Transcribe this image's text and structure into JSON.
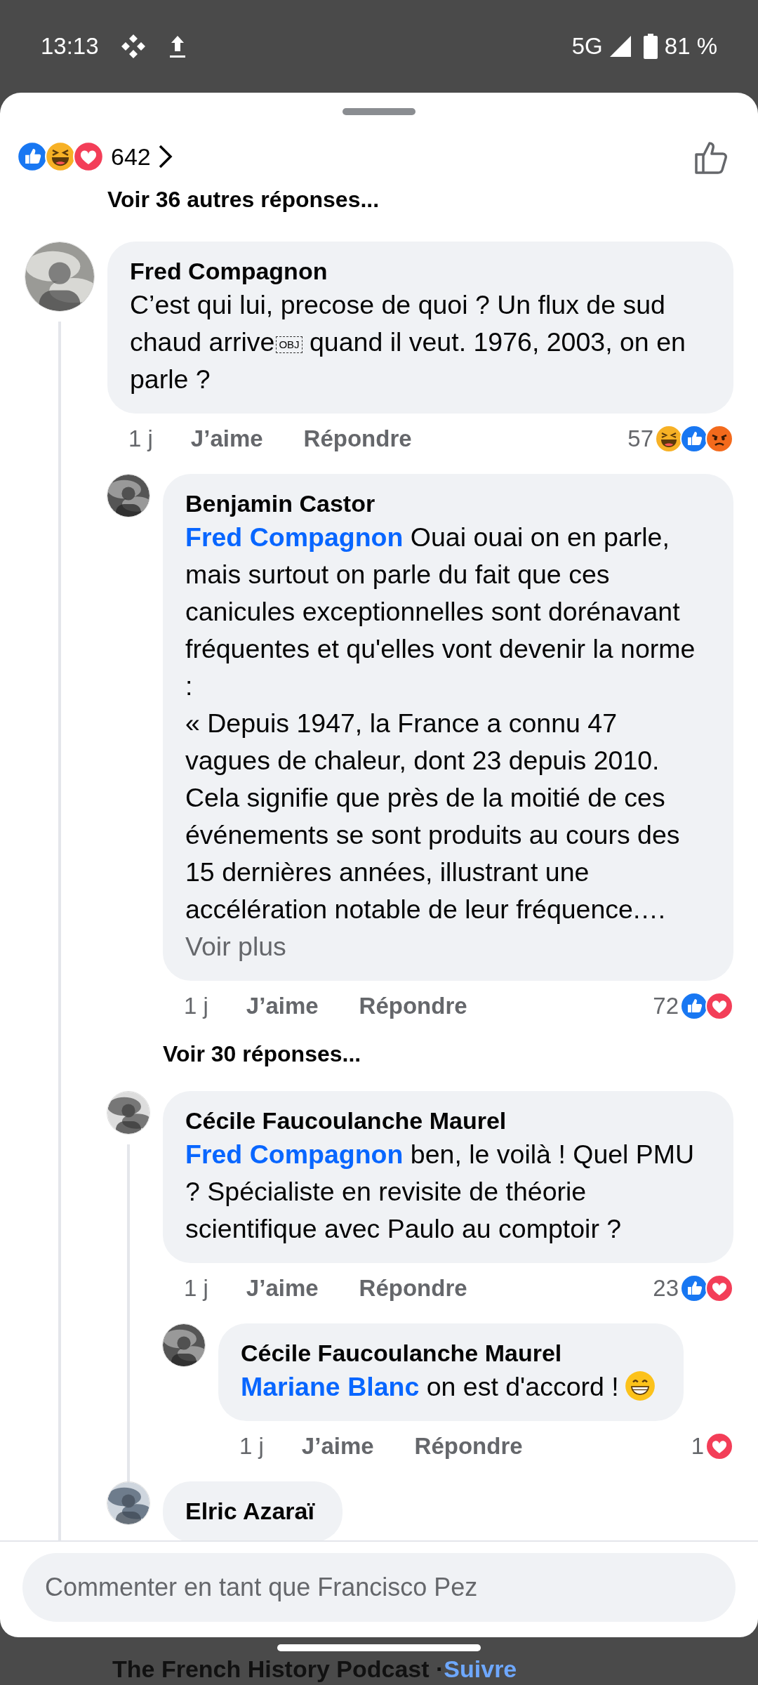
{
  "status_bar": {
    "time": "13:13",
    "network": "5G",
    "battery": "81 %"
  },
  "reactions_header": {
    "reactions": [
      {
        "kind": "like"
      },
      {
        "kind": "haha"
      },
      {
        "kind": "love"
      }
    ],
    "count": "642"
  },
  "previous_replies": "Voir 36 autres réponses...",
  "comments": [
    {
      "author": "Fred Compagnon",
      "text": "C’est qui lui, precose de quoi ? Un flux de sud chaud arrive",
      "object_marker": "OBJ",
      "text_after": " quand il veut. 1976, 2003, on en parle ?",
      "time": "1 j",
      "like": "J’aime",
      "reply": "Répondre",
      "reaction_count": "57",
      "reactions": [
        {
          "kind": "haha"
        },
        {
          "kind": "like"
        },
        {
          "kind": "angry"
        }
      ],
      "replies": [
        {
          "author": "Benjamin Castor",
          "mention": "Fred Compagnon",
          "text": "Ouai ouai on en parle, mais surtout on parle du fait que ces canicules exceptionnelles sont dorénavant fréquentes et qu'elles vont devenir la norme :\n« Depuis 1947, la France a connu 47 vagues de chaleur, dont 23 depuis 2010. Cela signifie que près de la moitié de ces événements se sont produits au cours des 15 dernières années, illustrant une accélération notable de leur fréquence.…",
          "see_more": "Voir plus",
          "time": "1 j",
          "like": "J’aime",
          "reply": "Répondre",
          "reaction_count": "72",
          "reactions": [
            {
              "kind": "like"
            },
            {
              "kind": "love"
            }
          ],
          "more_replies": "Voir 30 réponses..."
        },
        {
          "author": "Cécile Faucoulanche Maurel",
          "mention": "Fred Compagnon",
          "text": "ben, le voilà ! Quel PMU ? Spécialiste en revisite de théorie scientifique avec Paulo au comptoir ?",
          "time": "1 j",
          "like": "J’aime",
          "reply": "Répondre",
          "reaction_count": "23",
          "reactions": [
            {
              "kind": "like"
            },
            {
              "kind": "love"
            }
          ],
          "replies": [
            {
              "author": "Cécile Faucoulanche Maurel",
              "mention": "Mariane Blanc",
              "text": "on est d'accord !",
              "emoji": {
                "kind": "grin"
              },
              "time": "1 j",
              "like": "J’aime",
              "reply": "Répondre",
              "reaction_count": "1",
              "reactions": [
                {
                  "kind": "love"
                }
              ]
            }
          ]
        },
        {
          "author": "Elric Azaraï"
        }
      ]
    }
  ],
  "composer": {
    "placeholder": "Commenter en tant que Francisco Pez"
  },
  "background_post": {
    "title": "The French History Podcast · ",
    "follow": "Suivre"
  }
}
